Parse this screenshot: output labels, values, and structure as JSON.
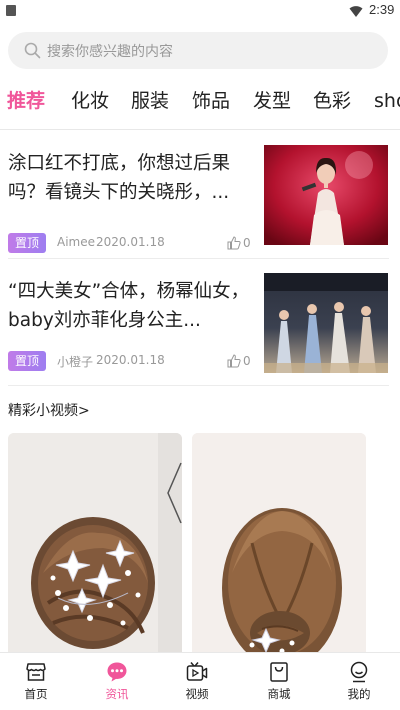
{
  "status_bar": {
    "time": "2:39"
  },
  "search": {
    "placeholder": "搜索你感兴趣的内容"
  },
  "tabs": [
    {
      "label": "推荐",
      "active": true
    },
    {
      "label": "化妆"
    },
    {
      "label": "服装"
    },
    {
      "label": "饰品"
    },
    {
      "label": "发型"
    },
    {
      "label": "色彩"
    },
    {
      "label": "sho"
    }
  ],
  "articles": [
    {
      "title": "涂口红不打底，你想过后果吗？看镜头下的关晓彤，...",
      "badge": "置顶",
      "author": "Aimee",
      "date": "2020.01.18",
      "likes": "0"
    },
    {
      "title": "“四大美女”合体，杨幂仙女，baby刘亦菲化身公主...",
      "badge": "置顶",
      "author": "小橙子",
      "date": "2020.01.18",
      "likes": "0"
    }
  ],
  "video_section": {
    "title": "精彩小视频>"
  },
  "bottom_nav": [
    {
      "label": "首页"
    },
    {
      "label": "资讯",
      "active": true
    },
    {
      "label": "视频"
    },
    {
      "label": "商城"
    },
    {
      "label": "我的"
    }
  ],
  "colors": {
    "accent": "#f0569a",
    "badge": "#b07ce9"
  }
}
